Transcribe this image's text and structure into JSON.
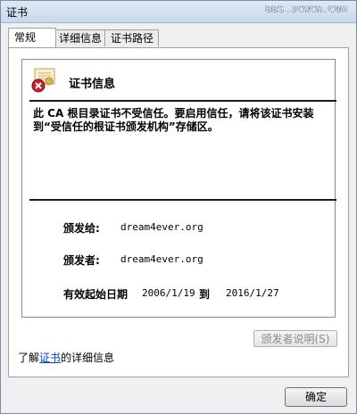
{
  "window": {
    "title": "证书",
    "watermark": "BBS.JCWCN.COM"
  },
  "tabs": [
    {
      "label": "常规",
      "active": true
    },
    {
      "label": "详细信息",
      "active": false
    },
    {
      "label": "证书路径",
      "active": false
    }
  ],
  "cert": {
    "icon": "certificate-error-icon",
    "heading": "证书信息",
    "warning": "此 CA 根目录证书不受信任。要启用信任，请将该证书安装到“受信任的根证书颁发机构”存储区。",
    "issued_to_label": "颁发给:",
    "issued_to_value": "dream4ever.org",
    "issued_by_label": "颁发者:",
    "issued_by_value": "dream4ever.org",
    "validity_label": "有效起始日期",
    "valid_from": "2006/1/19",
    "to_label": "到",
    "valid_to": "2016/1/27"
  },
  "issuer_statement_button": "颁发者说明(S)",
  "learn_more": {
    "prefix": "了解",
    "link": "证书",
    "suffix": "的详细信息"
  },
  "ok_button": "确定",
  "colors": {
    "link": "#0046d5",
    "error_badge": "#c8202a"
  }
}
